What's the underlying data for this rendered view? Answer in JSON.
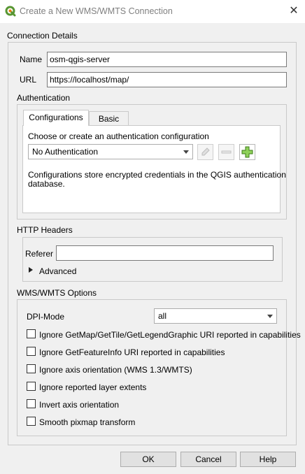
{
  "window": {
    "title": "Create a New WMS/WMTS Connection",
    "app_icon": "qgis-logo",
    "close_glyph": "✕"
  },
  "connection": {
    "section_label": "Connection Details",
    "name_label": "Name",
    "name_value": "osm-qgis-server",
    "url_label": "URL",
    "url_value": "https://localhost/map/"
  },
  "authentication": {
    "section_label": "Authentication",
    "tabs": [
      {
        "label": "Configurations",
        "active": true
      },
      {
        "label": "Basic",
        "active": false
      }
    ],
    "prompt": "Choose or create an authentication configuration",
    "selected_config": "No Authentication",
    "tool_icons": [
      "edit-icon",
      "remove-icon",
      "add-icon"
    ],
    "info_line1": "Configurations store encrypted credentials in the QGIS authentication",
    "info_line2": "database."
  },
  "http_headers": {
    "section_label": "HTTP Headers",
    "referer_label": "Referer",
    "referer_value": "",
    "advanced_label": "Advanced"
  },
  "wms_options": {
    "section_label": "WMS/WMTS Options",
    "dpi_label": "DPI-Mode",
    "dpi_value": "all",
    "checkboxes": [
      {
        "label": "Ignore GetMap/GetTile/GetLegendGraphic URI reported in capabilities",
        "checked": false
      },
      {
        "label": "Ignore GetFeatureInfo URI reported in capabilities",
        "checked": false
      },
      {
        "label": "Ignore axis orientation (WMS 1.3/WMTS)",
        "checked": false
      },
      {
        "label": "Ignore reported layer extents",
        "checked": false
      },
      {
        "label": "Invert axis orientation",
        "checked": false
      },
      {
        "label": "Smooth pixmap transform",
        "checked": false
      }
    ]
  },
  "buttons": {
    "ok": "OK",
    "cancel": "Cancel",
    "help": "Help"
  },
  "colors": {
    "qgis_green": "#589632",
    "qgis_yellow": "#ee7913"
  }
}
